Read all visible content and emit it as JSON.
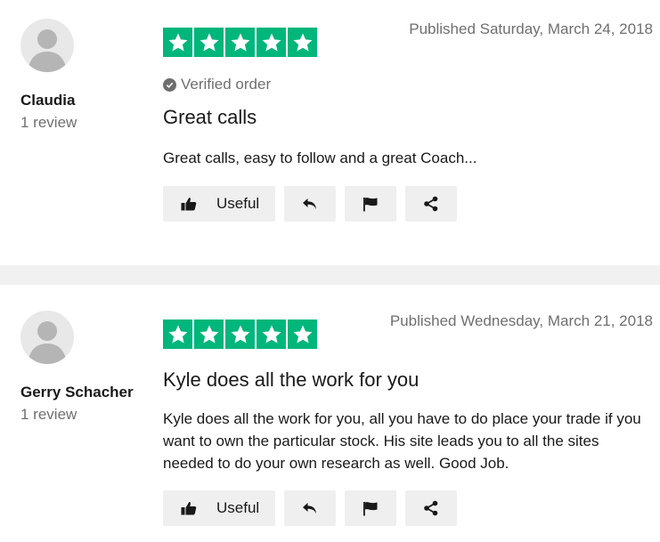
{
  "reviews": [
    {
      "name": "Claudia",
      "review_count": "1 review",
      "rating": 5,
      "published": "Published Saturday, March 24, 2018",
      "verified": "Verified order",
      "title": "Great calls",
      "body": "Great calls, easy to follow and a great Coach...",
      "useful_label": "Useful"
    },
    {
      "name": "Gerry Schacher",
      "review_count": "1 review",
      "rating": 5,
      "published": "Published Wednesday, March 21, 2018",
      "title": "Kyle does all the work for you",
      "body": "Kyle does all the work for you, all you have to do place your trade if you want to own the particular stock. His site leads you to all the sites needed to do your own research as well. Good Job.",
      "useful_label": "Useful"
    }
  ],
  "colors": {
    "star_green": "#00b67a",
    "separator": "#f1f1f1",
    "button_bg": "#efefef",
    "muted_text": "#6f6f6f"
  },
  "icons": [
    "avatar-icon",
    "star-icon",
    "check-circle-icon",
    "thumbs-up-icon",
    "reply-icon",
    "flag-icon",
    "share-icon"
  ]
}
